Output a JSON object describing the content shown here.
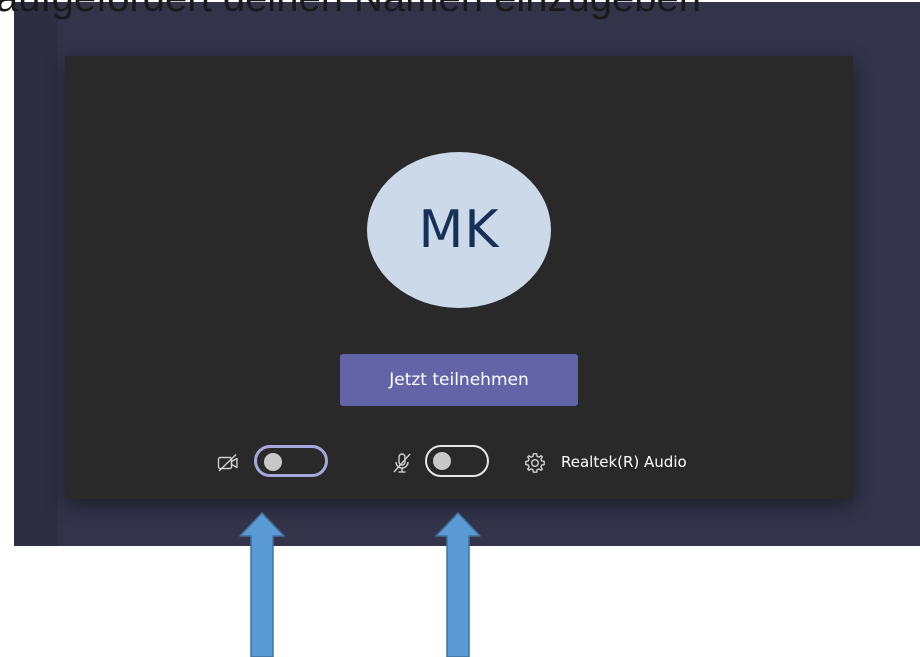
{
  "caption": {
    "text": "aufgefordert deinen Namen einzugeben"
  },
  "prejoin": {
    "avatar_initials": "MK",
    "join_button_label": "Jetzt teilnehmen",
    "video_toggle": {
      "state": "off",
      "icon": "camera-off-icon"
    },
    "mic_toggle": {
      "state": "off",
      "icon": "mic-off-icon"
    },
    "settings_icon": "gear-icon",
    "audio_device_label": "Realtek(R) Audio"
  },
  "annotations": {
    "arrow_color": "#5b9bd5",
    "arrows": [
      {
        "target": "video-toggle",
        "direction": "up"
      },
      {
        "target": "mic-toggle",
        "direction": "up"
      }
    ]
  },
  "colors": {
    "backdrop": "#33344a",
    "panel": "#292929",
    "avatar_bg": "#cbd9e8",
    "avatar_text": "#173058",
    "join_button": "#6264a7",
    "video_toggle_border": "#a6a7dc"
  }
}
